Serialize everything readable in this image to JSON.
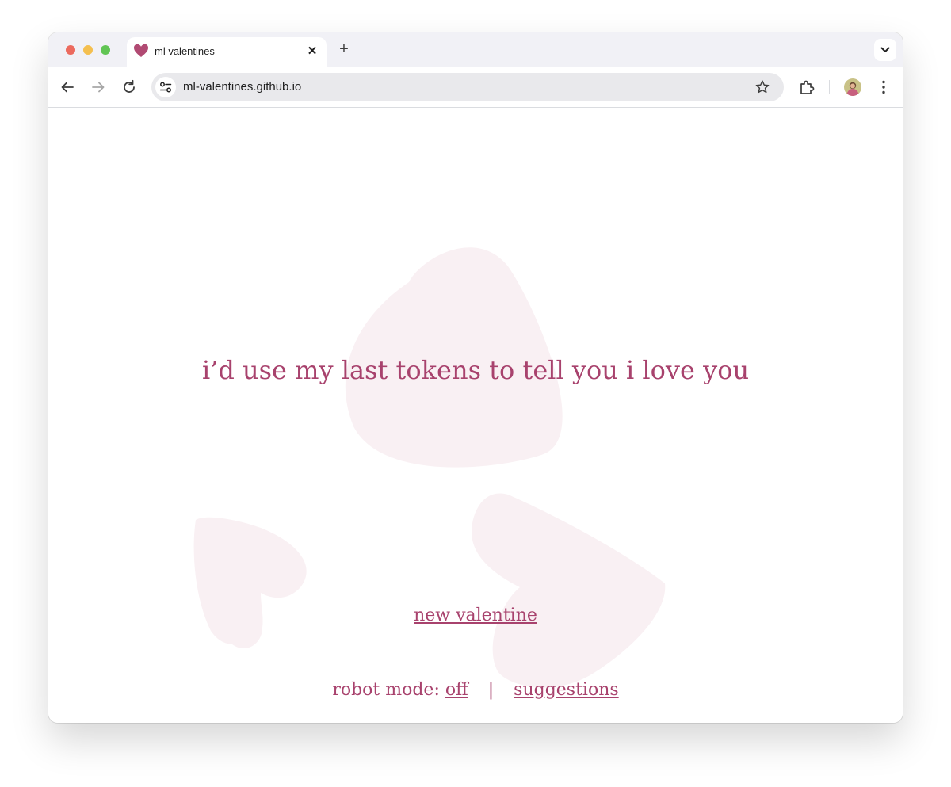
{
  "browser": {
    "tab": {
      "title": "ml valentines",
      "close_label": "✕"
    },
    "new_tab_label": "+",
    "url": "ml-valentines.github.io"
  },
  "page": {
    "headline": "i’d use my last tokens to tell you i love you",
    "new_valentine_label": "new valentine",
    "robot_mode_label": "robot mode:",
    "robot_mode_value": "off",
    "separator": "|",
    "suggestions_label": "suggestions"
  },
  "colors": {
    "accent": "#a8426d",
    "background_heart": "#f9f0f3",
    "favicon": "#b14a73"
  }
}
